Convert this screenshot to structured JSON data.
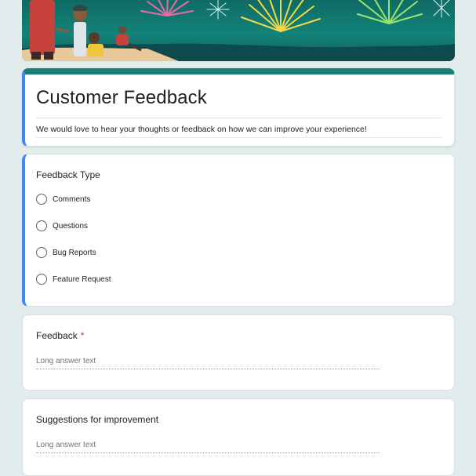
{
  "banner": {
    "image": "fireworks-celebration-illustration"
  },
  "form": {
    "title": "Customer Feedback",
    "description": "We would love to hear your thoughts or feedback on how we can improve your experience!",
    "accent_color": "#1e7f74",
    "active_color": "#4285f4",
    "required_marker": "*"
  },
  "questions": {
    "feedback_type": {
      "label": "Feedback Type",
      "options": [
        "Comments",
        "Questions",
        "Bug Reports",
        "Feature Request"
      ]
    },
    "feedback": {
      "label": "Feedback",
      "required": true,
      "placeholder": "Long answer text"
    },
    "suggestions": {
      "label": "Suggestions for improvement",
      "placeholder": "Long answer text"
    }
  }
}
